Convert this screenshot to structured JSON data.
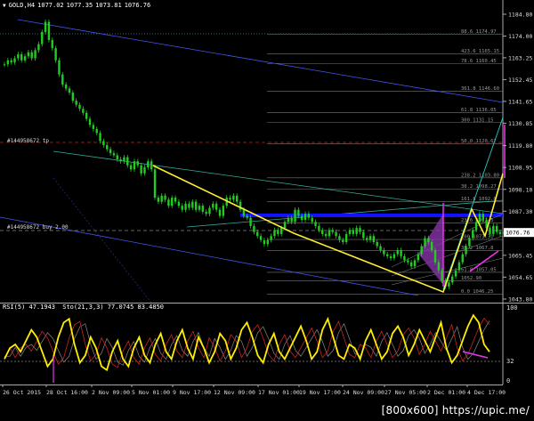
{
  "chart": {
    "symbol": "GOLD,H4",
    "ohlc": [
      "1077.02",
      "1077.35",
      "1073.81",
      "1076.76"
    ]
  },
  "price_axis": {
    "ticks": [
      "1184.80",
      "1174.00",
      "1163.25",
      "1152.45",
      "1141.65",
      "1130.85",
      "1119.80",
      "1108.95",
      "1098.10",
      "1087.30",
      "1076.50",
      "1065.45",
      "1054.65",
      "1043.80"
    ],
    "current": "1076.76"
  },
  "fib_levels": [
    "88.6 1174.97",
    "423.6 1165.15",
    "78.6 1160.45",
    "361.8 1146.60",
    "61.8 1136.05",
    "300 1131.15",
    "50.0 1120.67",
    "238.2 1103.80",
    "38.2 1098.27",
    "161.8 1092.0",
    "23.6 1081.5",
    "100 1073.31",
    "38.2 1067.8",
    "61.8 1057.05",
    "1052.90",
    "0.0 1046.25"
  ],
  "orders": {
    "tp_label": "#144958672 tp",
    "buy_label": "#144958672 buy 2.00"
  },
  "indicator": {
    "rsi_label": "RSI(5) 47.1943",
    "stoch_label": "Sto(21,3,3) 77.0745 83.4850",
    "axis_top": "100",
    "axis_mid": "32",
    "axis_bottom": "0"
  },
  "time_axis": [
    "26 Oct 2015",
    "28 Oct 16:00",
    "2 Nov 09:00",
    "5 Nov 01:00",
    "9 Nov 17:00",
    "12 Nov 09:00",
    "17 Nov 01:00",
    "19 Nov 17:00",
    "24 Nov 09:00",
    "27 Nov 05:00",
    "2 Dec 01:00",
    "4 Dec 17:00"
  ],
  "watermark": "[800x600] https://upic.me/",
  "colors": {
    "background": "#000000",
    "candles": "#22cc22",
    "fib_lines": "#777777",
    "channel_blue": "#4455ee",
    "trend_yellow": "#ffee33",
    "rsi": "#ffee00",
    "stoch_main": "#cc2222",
    "stoch_signal": "#888888",
    "pivot_bar": "#1111ff",
    "fan_fill": "#8833aa",
    "cyan_line": "#22cccc",
    "magenta": "#ee33ee"
  }
}
